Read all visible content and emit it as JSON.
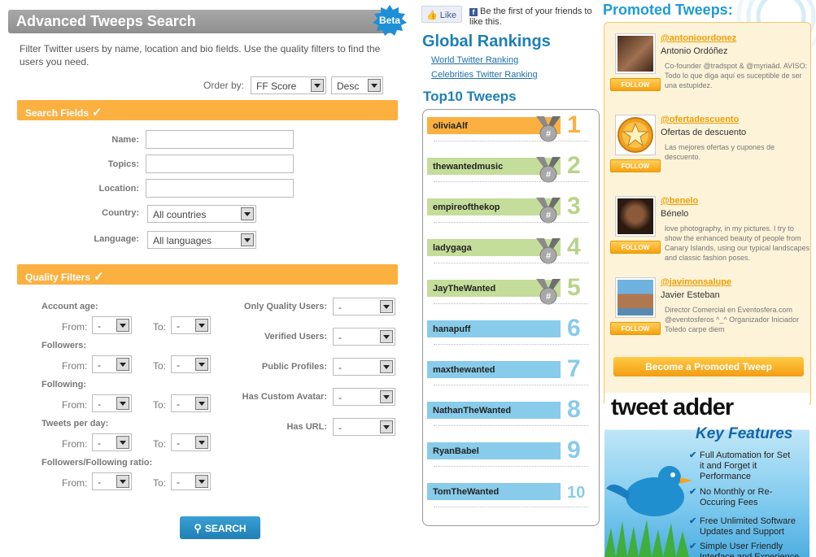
{
  "search_header": {
    "title": "Advanced Tweeps Search",
    "badge": "Beta"
  },
  "intro": "Filter Twitter users by name, location and bio fields. Use the quality filters to find the users you need.",
  "order_by": {
    "label": "Order by:",
    "field_value": "FF Score",
    "direction_value": "Desc"
  },
  "search_fields": {
    "title": "Search Fields",
    "check_glyph": "✓",
    "name_label": "Name:",
    "topics_label": "Topics:",
    "location_label": "Location:",
    "country_label": "Country:",
    "country_value": "All countries",
    "language_label": "Language:",
    "language_value": "All languages"
  },
  "quality_filters": {
    "title": "Quality Filters",
    "check_glyph": "✓",
    "from_label": "From:",
    "to_label": "To:",
    "range_value": "-",
    "account_age_label": "Account age:",
    "followers_label": "Followers:",
    "following_label": "Following:",
    "tweets_per_day_label": "Tweets per day:",
    "ratio_label": "Followers/Following ratio:",
    "only_quality_label": "Only Quality Users:",
    "verified_label": "Verified Users:",
    "public_label": "Public Profiles:",
    "avatar_label": "Has Custom Avatar:",
    "url_label": "Has URL:",
    "option_value": "-"
  },
  "search_button": {
    "label": "SEARCH",
    "icon": "magnifier-icon"
  },
  "facebook": {
    "like_label": "Like",
    "text": "Be the first of your friends to like this."
  },
  "global_rankings": {
    "title": "Global Rankings",
    "links": [
      "World Twitter Ranking",
      "Celebrities Twitter Ranking"
    ]
  },
  "top10": {
    "title": "Top10 Tweeps",
    "items": [
      {
        "name": "oliviaAlf",
        "rank": "1",
        "bar": "#fbb040",
        "num": "#fbb040"
      },
      {
        "name": "thewantedmusic",
        "rank": "2",
        "bar": "#c4dd9a",
        "num": "#b6d488"
      },
      {
        "name": "empireofthekop",
        "rank": "3",
        "bar": "#c4dd9a",
        "num": "#b6d488"
      },
      {
        "name": "ladygaga",
        "rank": "4",
        "bar": "#c4dd9a",
        "num": "#b6d488"
      },
      {
        "name": "JayTheWanted",
        "rank": "5",
        "bar": "#c4dd9a",
        "num": "#b6d488"
      },
      {
        "name": "hanapuff",
        "rank": "6",
        "bar": "#88cbea",
        "num": "#88cbea"
      },
      {
        "name": "maxthewanted",
        "rank": "7",
        "bar": "#88cbea",
        "num": "#88cbea"
      },
      {
        "name": "NathanTheWanted",
        "rank": "8",
        "bar": "#88cbea",
        "num": "#88cbea"
      },
      {
        "name": "RyanBabel",
        "rank": "9",
        "bar": "#88cbea",
        "num": "#88cbea"
      },
      {
        "name": "TomTheWanted",
        "rank": "10",
        "bar": "#88cbea",
        "num": "#88cbea"
      }
    ]
  },
  "promoted": {
    "title": "Promoted Tweeps:",
    "follow_label": "FOLLOW",
    "items": [
      {
        "handle": "@antonioordonez",
        "name": "Antonio Ordóñez",
        "bio": "Co-founder @tradspot & @myriaâd. AVISO: Todo lo que diga aquí es suceptible de ser una estupidez."
      },
      {
        "handle": "@ofertadescuento",
        "name": "Ofertas de descuento",
        "bio": "Las mejores ofertas y cupones de descuento."
      },
      {
        "handle": "@benelo",
        "name": "Bénelo",
        "bio": "love photography, in my pictures. I try to show the enhanced beauty of people from Canary Islands, using our typical landscapes and classic fashion poses."
      },
      {
        "handle": "@javimonsalupe",
        "name": "Javier Esteban",
        "bio": "Director Comercial en Eventosfera.com @eventosferos ^_^ Organizador Iniciador Toledo carpe diem"
      }
    ],
    "become_label": "Become a Promoted Tweep"
  },
  "ad": {
    "brand": "tweet adder",
    "heading": "Key Features",
    "features": [
      "Full Automation for Set it and Forget it Performance",
      "No Monthly or Re-Occuring Fees",
      "Free Unlimited Software Updates and Support",
      "Simple User Friendly Interface and Experience"
    ]
  }
}
